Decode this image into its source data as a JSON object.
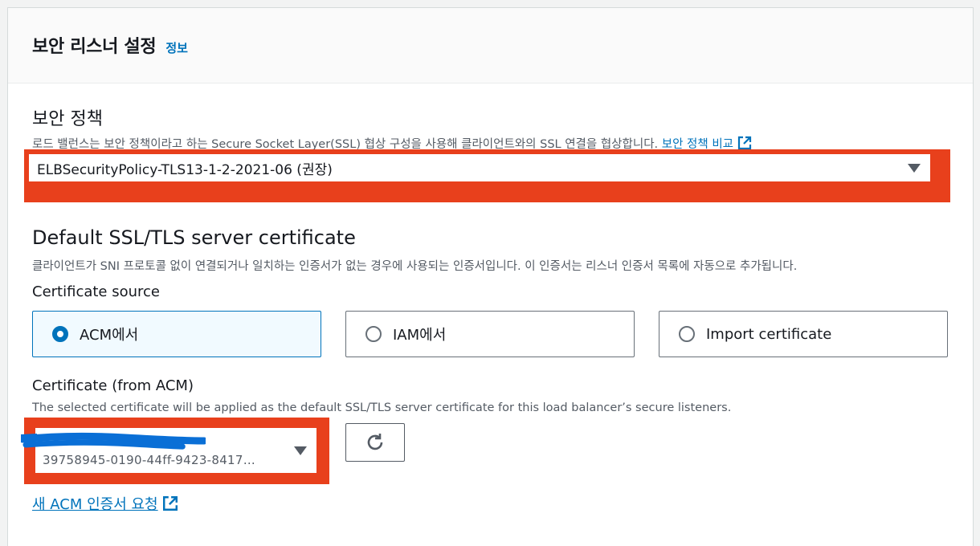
{
  "header": {
    "title": "보안 리스너 설정",
    "info_link": "정보"
  },
  "security_policy": {
    "heading": "보안 정책",
    "description": "로드 밸런스는 보안 정책이라고 하는 Secure Socket Layer(SSL) 협상 구성을 사용해 클라이언트와의 SSL 연결을 협상합니다.",
    "compare_link": "보안 정책 비교",
    "selected_value": "ELBSecurityPolicy-TLS13-1-2-2021-06 (권장)"
  },
  "default_cert": {
    "heading": "Default SSL/TLS server certificate",
    "description": "클라이언트가 SNI 프로토콜 없이 연결되거나 일치하는 인증서가 없는 경우에 사용되는 인증서입니다. 이 인증서는 리스너 인증서 목록에 자동으로 추가됩니다.",
    "source_label": "Certificate source",
    "sources": [
      {
        "label": "ACM에서",
        "selected": true
      },
      {
        "label": "IAM에서",
        "selected": false
      },
      {
        "label": "Import certificate",
        "selected": false
      }
    ]
  },
  "acm_cert": {
    "label": "Certificate (from ACM)",
    "description": "The selected certificate will be applied as the default SSL/TLS server certificate for this load balancer’s secure listeners.",
    "selected_id": "39758945-0190-44ff-9423-8417…",
    "request_link": "새 ACM 인증서 요청"
  },
  "colors": {
    "link": "#0073bb",
    "highlight_frame": "#e8401c",
    "redaction": "#0a6fd6"
  }
}
